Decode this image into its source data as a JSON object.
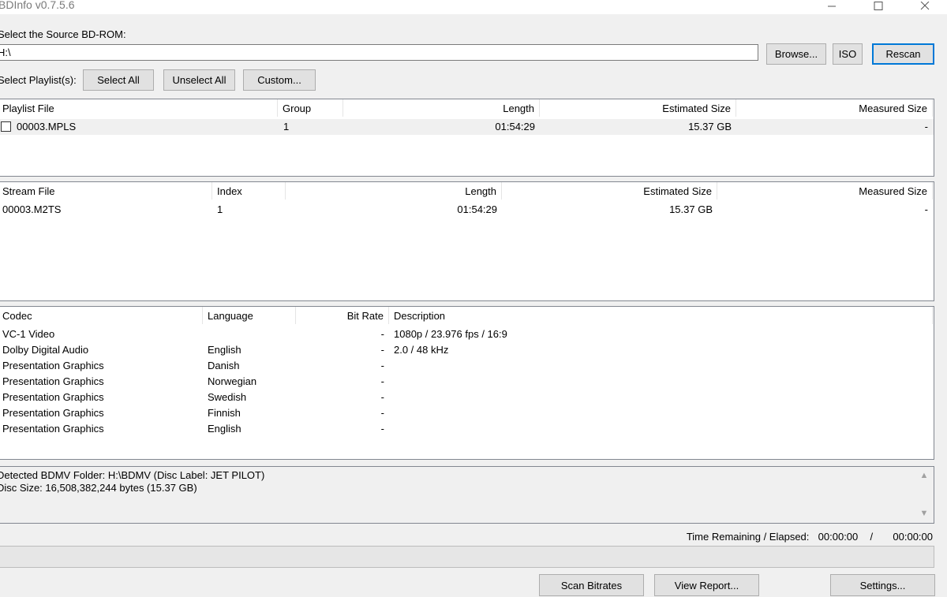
{
  "window": {
    "title": "BDInfo v0.7.5.6",
    "controls": [
      "minimize-icon",
      "maximize-icon",
      "close-icon"
    ]
  },
  "source": {
    "label": "Select the Source BD-ROM:",
    "path_value": "H:\\",
    "browse_label": "Browse...",
    "iso_label": "ISO",
    "rescan_label": "Rescan"
  },
  "playlist_controls": {
    "label": "Select Playlist(s):",
    "select_all_label": "Select All",
    "unselect_all_label": "Unselect All",
    "custom_label": "Custom..."
  },
  "playlists": {
    "headers": {
      "file": "Playlist File",
      "group": "Group",
      "length": "Length",
      "estimated": "Estimated Size",
      "measured": "Measured Size"
    },
    "rows": [
      {
        "file": "00003.MPLS",
        "group": "1",
        "length": "01:54:29",
        "estimated": "15.37 GB",
        "measured": "-",
        "checked": false
      }
    ]
  },
  "streams": {
    "headers": {
      "file": "Stream File",
      "index": "Index",
      "length": "Length",
      "estimated": "Estimated Size",
      "measured": "Measured Size"
    },
    "rows": [
      {
        "file": "00003.M2TS",
        "index": "1",
        "length": "01:54:29",
        "estimated": "15.37 GB",
        "measured": "-"
      }
    ]
  },
  "codecs": {
    "headers": {
      "codec": "Codec",
      "language": "Language",
      "bitrate": "Bit Rate",
      "description": "Description"
    },
    "rows": [
      {
        "codec": "VC-1 Video",
        "language": "",
        "bitrate": "-",
        "description": "1080p / 23.976 fps / 16:9"
      },
      {
        "codec": "Dolby Digital Audio",
        "language": "English",
        "bitrate": "-",
        "description": "2.0 / 48 kHz"
      },
      {
        "codec": "Presentation Graphics",
        "language": "Danish",
        "bitrate": "-",
        "description": ""
      },
      {
        "codec": "Presentation Graphics",
        "language": "Norwegian",
        "bitrate": "-",
        "description": ""
      },
      {
        "codec": "Presentation Graphics",
        "language": "Swedish",
        "bitrate": "-",
        "description": ""
      },
      {
        "codec": "Presentation Graphics",
        "language": "Finnish",
        "bitrate": "-",
        "description": ""
      },
      {
        "codec": "Presentation Graphics",
        "language": "English",
        "bitrate": "-",
        "description": ""
      }
    ]
  },
  "log": {
    "lines": [
      "Detected BDMV Folder: H:\\BDMV (Disc Label: JET PILOT)",
      "Disc Size: 16,508,382,244 bytes (15.37 GB)"
    ]
  },
  "status": {
    "time_label": "Time Remaining / Elapsed:",
    "remaining": "00:00:00",
    "separator": "/",
    "elapsed": "00:00:00",
    "progress_fraction": 0
  },
  "actions": {
    "scan_label": "Scan Bitrates",
    "report_label": "View Report...",
    "settings_label": "Settings..."
  },
  "colors": {
    "window_bg": "#f0f0f0",
    "default_button_border": "#0078d7",
    "panel_border": "#828790"
  }
}
